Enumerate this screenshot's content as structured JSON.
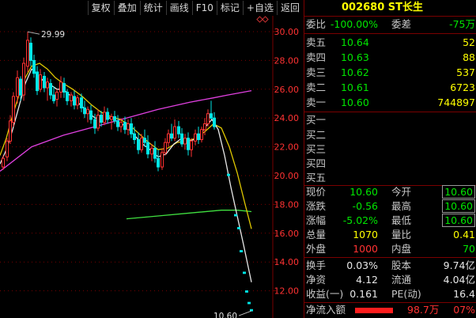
{
  "toolbar": {
    "buttons": [
      "复权",
      "叠加",
      "统计",
      "画线",
      "F10",
      "标记",
      "+自选",
      "返回"
    ]
  },
  "chart": {
    "price_axis": [
      "30.00",
      "28.00",
      "26.00",
      "24.00",
      "22.00",
      "20.00",
      "18.00",
      "16.00",
      "14.00",
      "12.00"
    ],
    "high_marker": "29.99",
    "last_marker": "10.60",
    "colors": {
      "up": "#ff3232",
      "down": "#00e6e6",
      "ma_white": "#e8e8e8",
      "ma_yellow": "#e0c800",
      "ma_magenta": "#e040e0",
      "ma_green": "#40e040",
      "grid": "#7a0000"
    }
  },
  "panel": {
    "title": "002680 ST长生",
    "weibi": {
      "label": "委比",
      "value": "-100.00%",
      "label2": "委差",
      "value2": "-75万"
    },
    "asks": [
      {
        "label": "卖五",
        "price": "10.64",
        "vol": "52"
      },
      {
        "label": "卖四",
        "price": "10.63",
        "vol": "88"
      },
      {
        "label": "卖三",
        "price": "10.62",
        "vol": "537"
      },
      {
        "label": "卖二",
        "price": "10.61",
        "vol": "6723"
      },
      {
        "label": "卖一",
        "price": "10.60",
        "vol": "744897"
      }
    ],
    "bids": [
      {
        "label": "买一"
      },
      {
        "label": "买二"
      },
      {
        "label": "买三"
      },
      {
        "label": "买四"
      },
      {
        "label": "买五"
      }
    ],
    "quote": [
      {
        "l1": "现价",
        "v1": "10.60",
        "l2": "今开",
        "v2": "10.60"
      },
      {
        "l1": "涨跌",
        "v1": "-0.56",
        "l2": "最高",
        "v2": "10.60"
      },
      {
        "l1": "涨幅",
        "v1": "-5.02%",
        "l2": "最低",
        "v2": "10.60"
      },
      {
        "l1": "总量",
        "v1": "1070",
        "l2": "量比",
        "v2": "0.41"
      },
      {
        "l1": "外盘",
        "v1": "1000",
        "l2": "内盘",
        "v2": "70"
      }
    ],
    "fund": [
      {
        "l1": "换手",
        "v1": "0.03%",
        "l2": "股本",
        "v2": "9.74亿"
      },
      {
        "l1": "净资",
        "v1": "4.12",
        "l2": "流通",
        "v2": "4.04亿"
      },
      {
        "l1": "收益(一)",
        "v1": "0.161",
        "l2": "PE(动)",
        "v2": "16.4"
      }
    ],
    "netflow": {
      "label": "净流入额",
      "value": "98.7万",
      "pct": "07%"
    }
  }
}
